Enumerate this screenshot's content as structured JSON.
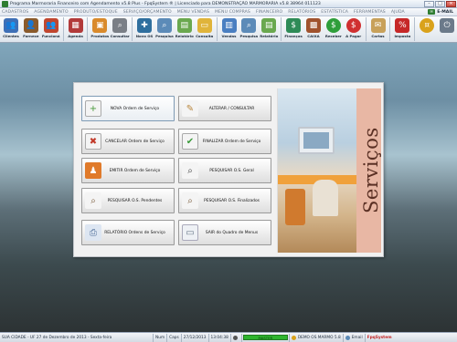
{
  "window": {
    "title": "Programa Marmoraria Financeiro com Agendamento v5.8 Plus - FpqSystem ® | Licenciado para DEMONSTRAÇÃO MARMORARIA v5.8 38964 011123"
  },
  "menu": {
    "items": [
      "CADASTROS",
      "AGENDAMENTO",
      "PRODUTO/ESTOQUE",
      "SERVIÇO/ORÇAMENTO",
      "MENU VENDAS",
      "MENU COMPRAS",
      "FINANCEIRO",
      "RELATÓRIOS",
      "ESTATÍSTICA",
      "FERRAMENTAS",
      "AJUDA"
    ],
    "email_label": "E-MAIL"
  },
  "toolbar": {
    "items": [
      {
        "label": "Clientes",
        "icon": "clients-icon",
        "color": "#3d6fb6"
      },
      {
        "label": "Fornece",
        "icon": "suppliers-icon",
        "color": "#8a5a2b"
      },
      {
        "label": "Funcioná",
        "icon": "employees-icon",
        "color": "#c0462f"
      },
      {
        "label": "Agenda",
        "icon": "calendar-icon",
        "color": "#b23a3a"
      },
      {
        "label": "Produtos",
        "icon": "products-icon",
        "color": "#d98a2b"
      },
      {
        "label": "Consultar",
        "icon": "stock-search-icon",
        "color": "#7a7f86"
      },
      {
        "label": "Novo OS",
        "icon": "new-os-icon",
        "color": "#2f6f9e"
      },
      {
        "label": "Pesquisa",
        "icon": "search-icon",
        "color": "#5c8bb8"
      },
      {
        "label": "Relatório",
        "icon": "report-icon",
        "color": "#6aa84f"
      },
      {
        "label": "Consulta",
        "icon": "consult-icon",
        "color": "#e0b43a"
      },
      {
        "label": "Vendas",
        "icon": "sales-icon",
        "color": "#4a7fc1"
      },
      {
        "label": "Pesquisa",
        "icon": "sales-search-icon",
        "color": "#5c8bb8"
      },
      {
        "label": "Relatório",
        "icon": "sales-report-icon",
        "color": "#6aa84f"
      },
      {
        "label": "Finanças",
        "icon": "finance-icon",
        "color": "#2e8b57"
      },
      {
        "label": "CAIXA",
        "icon": "cashbox-icon",
        "color": "#a0522d"
      },
      {
        "label": "Receber",
        "icon": "receive-icon",
        "color": "#2e9e3a"
      },
      {
        "label": "A Pagar",
        "icon": "pay-icon",
        "color": "#d03030"
      },
      {
        "label": "Cartas",
        "icon": "letters-icon",
        "color": "#c8a15a"
      },
      {
        "label": "Imposto",
        "icon": "tax-icon",
        "color": "#c62828"
      },
      {
        "label": "",
        "icon": "gold-coin-icon",
        "color": "#d9a21b"
      },
      {
        "label": "",
        "icon": "exit-icon",
        "color": "#6b7a8a"
      }
    ]
  },
  "panel": {
    "buttons": [
      {
        "label": "NOVA Ordem de Serviço",
        "icon": "new-document-icon",
        "color": "#4a9a3c"
      },
      {
        "label": "ALTERAR / CONSULTAR",
        "icon": "pencil-icon",
        "color": "#c9a15c"
      },
      {
        "label": "CANCELAR Ordem de Serviço",
        "icon": "cancel-document-icon",
        "color": "#c23a2a"
      },
      {
        "label": "FINALIZAR Ordem de Serviço",
        "icon": "check-document-icon",
        "color": "#3a9a3a"
      },
      {
        "label": "EMITIR Ordem de Serviço",
        "icon": "person-icon",
        "color": "#e07a2a"
      },
      {
        "label": "PESQUISAR O.S. Geral",
        "icon": "binoculars-icon",
        "color": "#5a5a5a"
      },
      {
        "label": "PESQUISAR O.S. Pendentes",
        "icon": "search-pending-icon",
        "color": "#7a5a3a"
      },
      {
        "label": "PESQUISAR O.S. Finalizados",
        "icon": "search-finished-icon",
        "color": "#7a5a3a"
      },
      {
        "label": "RELATÓRIO Ordens de Serviço",
        "icon": "printer-icon",
        "color": "#6a86b0"
      },
      {
        "label": "SAIR do Quadro de Menus",
        "icon": "exit-menu-icon",
        "color": "#8a9aaa"
      }
    ],
    "art_word": "Serviços"
  },
  "status": {
    "city": "SUA CIDADE - UF 27 de Dezembro de 2013 - Sexta-feira",
    "num": "Num",
    "caps": "Caps",
    "date": "27/12/2013",
    "time": "13:04:38",
    "master": "MASTER",
    "demo": "DEMO OS MARMO 5.8",
    "email": "Email",
    "brand": "FpqSystem"
  }
}
